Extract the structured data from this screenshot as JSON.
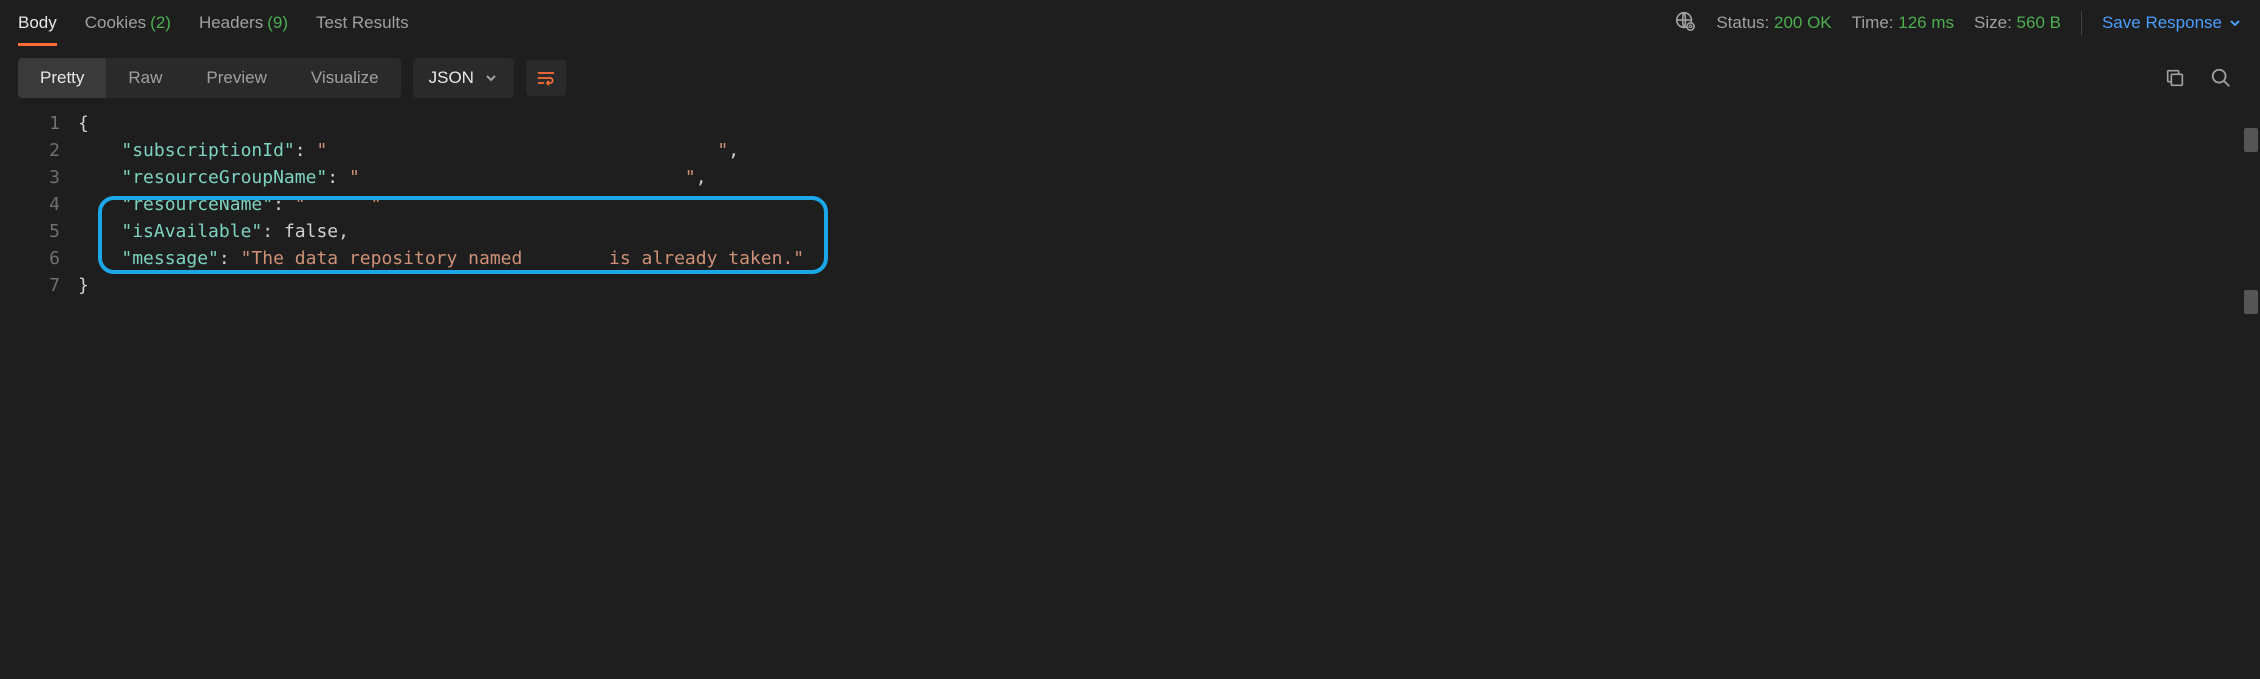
{
  "tabs": {
    "body": "Body",
    "cookies": "Cookies",
    "cookies_count": "(2)",
    "headers": "Headers",
    "headers_count": "(9)",
    "test_results": "Test Results"
  },
  "status": {
    "label": "Status:",
    "value": "200 OK",
    "time_label": "Time:",
    "time_value": "126 ms",
    "size_label": "Size:",
    "size_value": "560 B"
  },
  "save_response": "Save Response",
  "view_tabs": {
    "pretty": "Pretty",
    "raw": "Raw",
    "preview": "Preview",
    "visualize": "Visualize"
  },
  "format_dropdown": "JSON",
  "code": {
    "lines": [
      "1",
      "2",
      "3",
      "4",
      "5",
      "6",
      "7"
    ],
    "l1": "{",
    "l2_key": "\"subscriptionId\"",
    "l2_val": "\"                                    \"",
    "l3_key": "\"resourceGroupName\"",
    "l3_val": "\"                              \"",
    "l4_key": "\"resourceName\"",
    "l4_val": "\"      \"",
    "l5_key": "\"isAvailable\"",
    "l5_val": "false",
    "l6_key": "\"message\"",
    "l6_val": "\"The data repository named        is already taken.\"",
    "l7": "}"
  }
}
